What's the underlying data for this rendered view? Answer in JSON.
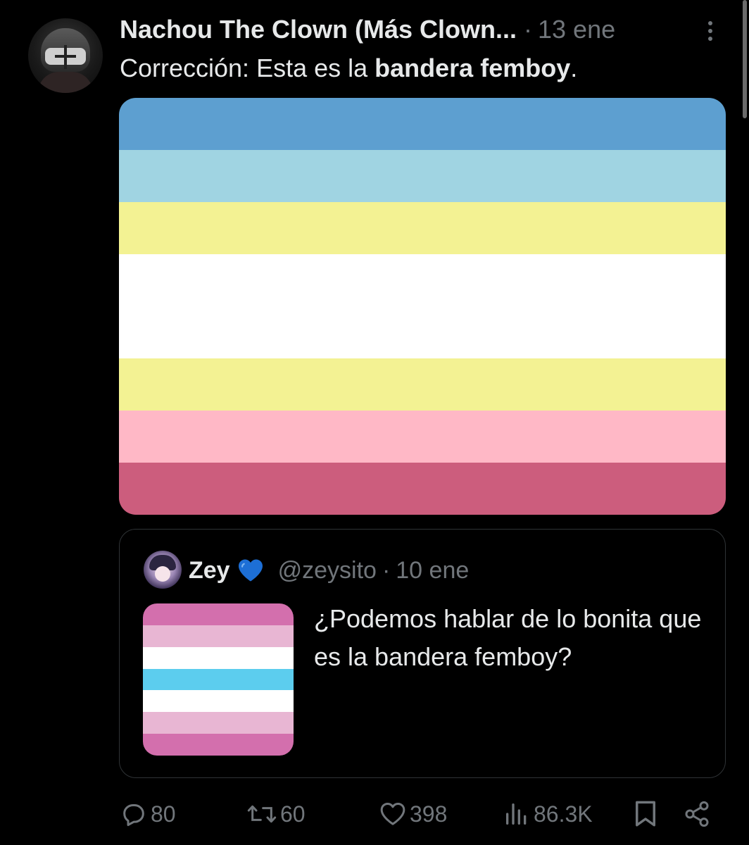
{
  "tweet": {
    "author_name": "Nachou The Clown (Más Clown...",
    "separator": "·",
    "date": "13 ene",
    "text_before": "Corrección: Esta es la ",
    "text_bold": "bandera femboy",
    "text_after": ".",
    "flag_colors": [
      "#5d9fd0",
      "#a0d4e2",
      "#f3f293",
      "#ffffff",
      "#f3f293",
      "#ffb8c6",
      "#cc5d7d"
    ],
    "flag_weights": [
      1,
      1,
      1,
      2,
      1,
      1,
      1
    ]
  },
  "quote": {
    "name": "Zey",
    "badge_emoji": "blue-heart",
    "handle": "@zeysito",
    "separator": "·",
    "date": "10 ene",
    "text": "¿Podemos hablar de lo bonita que es la bandera femboy?",
    "thumb_colors": [
      "#d36fad",
      "#e8b6d3",
      "#ffffff",
      "#5ccdee",
      "#ffffff",
      "#e8b6d3",
      "#d36fad"
    ]
  },
  "actions": {
    "replies": "80",
    "reposts": "60",
    "likes": "398",
    "views": "86.3K"
  },
  "colors": {
    "background": "#000000",
    "primary_text": "#e7e9ea",
    "secondary_text": "#71767b",
    "border": "#2f3336",
    "heart_blue": "#1d6fd6"
  }
}
